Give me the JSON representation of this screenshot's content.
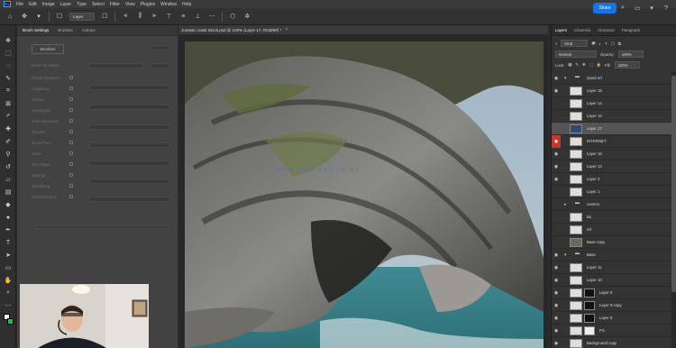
{
  "menubar": {
    "app_logo": "Ps",
    "items": [
      "File",
      "Edit",
      "Image",
      "Layer",
      "Type",
      "Select",
      "Filter",
      "View",
      "Plugins",
      "Window",
      "Help"
    ]
  },
  "options": {
    "mode_select": "Layer",
    "share_label": "Share"
  },
  "brush_panel": {
    "tabs": [
      "Brush Settings",
      "Brushes",
      "Actions"
    ],
    "presets_button": "Brushes",
    "settings": [
      "Brush Tip Shape",
      "Shape Dynamics",
      "Scattering",
      "Texture",
      "Dual Brush",
      "Color Dynamics",
      "Transfer",
      "Brush Pose",
      "Noise",
      "Wet Edges",
      "Build-up",
      "Smoothing",
      "Protect Texture"
    ]
  },
  "document": {
    "tab_title": "Jurassic coast Stock.psd @ 100% (Layer 17, RGB/8#) *",
    "close": "×",
    "overlay_text": "WWW.ABC.PHOTO.BE"
  },
  "right_panel": {
    "tabs": [
      "Layers",
      "Channels",
      "Character",
      "Paragraph"
    ],
    "filter_kind": "Kind",
    "blend_mode": "Normal",
    "opacity_label": "Opacity:",
    "opacity_value": "100%",
    "lock_label": "Lock:",
    "fill_label": "Fill:",
    "fill_value": "100%",
    "layers": [
      {
        "name": "stand ref",
        "type": "group",
        "visible": true
      },
      {
        "name": "Layer 15",
        "type": "layer",
        "visible": true
      },
      {
        "name": "Layer 14",
        "type": "layer",
        "visible": false
      },
      {
        "name": "Layer 12",
        "type": "layer",
        "visible": false
      },
      {
        "name": "Layer 17",
        "type": "layer",
        "visible": false,
        "selected": true
      },
      {
        "name": "INTERNET",
        "type": "layer",
        "visible": true,
        "flag": "red"
      },
      {
        "name": "Layer 16",
        "type": "layer",
        "visible": true
      },
      {
        "name": "Layer 13",
        "type": "layer",
        "visible": true
      },
      {
        "name": "Layer 2",
        "type": "layer",
        "visible": true
      },
      {
        "name": "Layer 1",
        "type": "layer",
        "visible": false
      },
      {
        "name": "comms",
        "type": "group",
        "visible": false
      },
      {
        "name": "tai",
        "type": "layer",
        "visible": false
      },
      {
        "name": "ref",
        "type": "layer",
        "visible": false
      },
      {
        "name": "Base copy",
        "type": "photo",
        "visible": false
      },
      {
        "name": "Base",
        "type": "group",
        "visible": true
      },
      {
        "name": "Layer 11",
        "type": "layer",
        "visible": true
      },
      {
        "name": "Layer 10",
        "type": "layer",
        "visible": true
      },
      {
        "name": "Layer 9",
        "type": "masked",
        "visible": true
      },
      {
        "name": "Layer 8 copy",
        "type": "masked",
        "visible": true
      },
      {
        "name": "Layer 8",
        "type": "masked",
        "visible": true
      },
      {
        "name": "FG",
        "type": "masked",
        "visible": true
      },
      {
        "name": "Background copy",
        "type": "layer",
        "visible": true
      }
    ]
  }
}
